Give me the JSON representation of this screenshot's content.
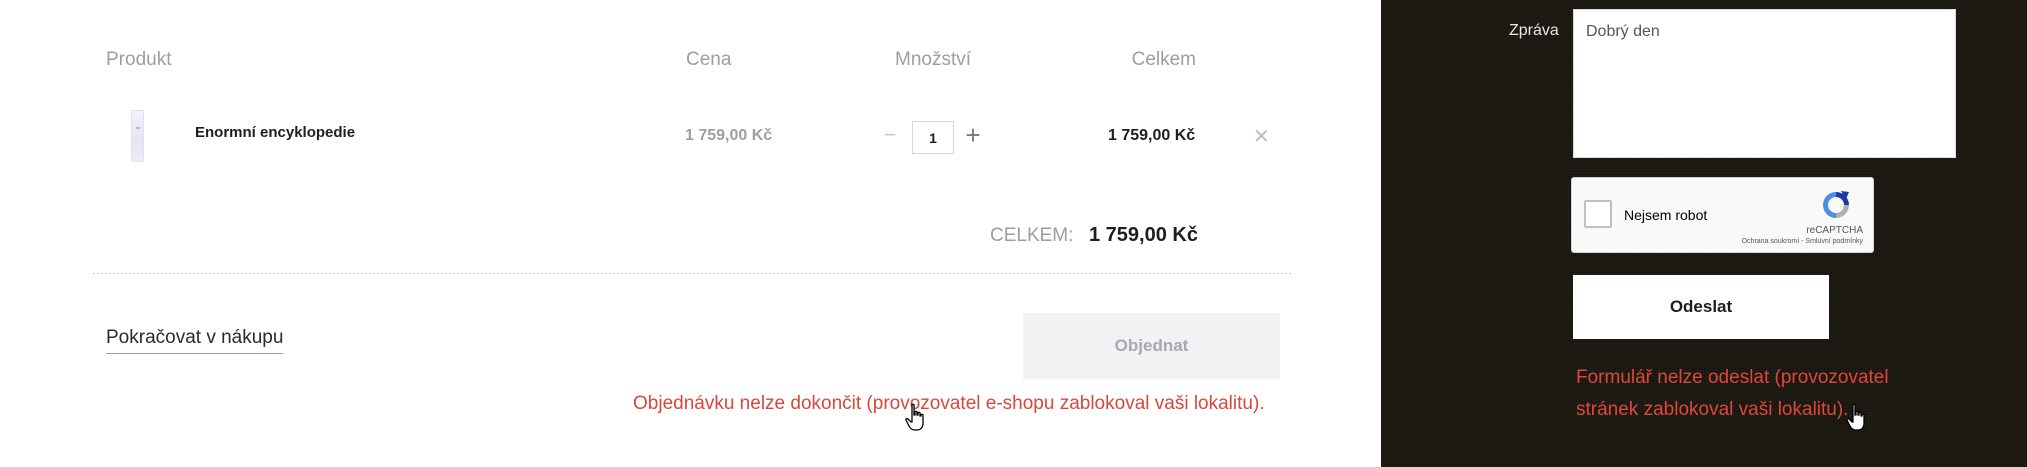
{
  "cart": {
    "headers": {
      "product": "Produkt",
      "price": "Cena",
      "quantity": "Množství",
      "total": "Celkem"
    },
    "item": {
      "name": "Enormní encyklopedie",
      "price": "1 759,00 Kč",
      "quantity": "1",
      "total": "1 759,00 Kč"
    },
    "summary": {
      "label": "CELKEM:",
      "value": "1 759,00 Kč"
    },
    "continue_label": "Pokračovat v nákupu",
    "order_label": "Objednat",
    "error": "Objednávku nelze dokončit (provozovatel e-shopu zablokoval vaši lokalitu)."
  },
  "form": {
    "message_label": "Zpráva",
    "message_value": "Dobrý den",
    "recaptcha": {
      "label": "Nejsem robot",
      "brand": "reCAPTCHA",
      "links": "Ochrana soukromí - Smluvní podmínky"
    },
    "submit_label": "Odeslat",
    "error": "Formulář nelze odeslat (provozovatel stránek zablokoval vaši lokalitu)."
  },
  "colors": {
    "error_red": "#d9473a",
    "panel_bg": "#1a1711",
    "muted_text": "#9e9e9e"
  },
  "icons": {
    "minus": "minus-icon",
    "plus": "plus-icon",
    "remove": "close-icon",
    "recaptcha": "recaptcha-logo-icon",
    "cursor": "hand-pointer-cursor-icon"
  }
}
